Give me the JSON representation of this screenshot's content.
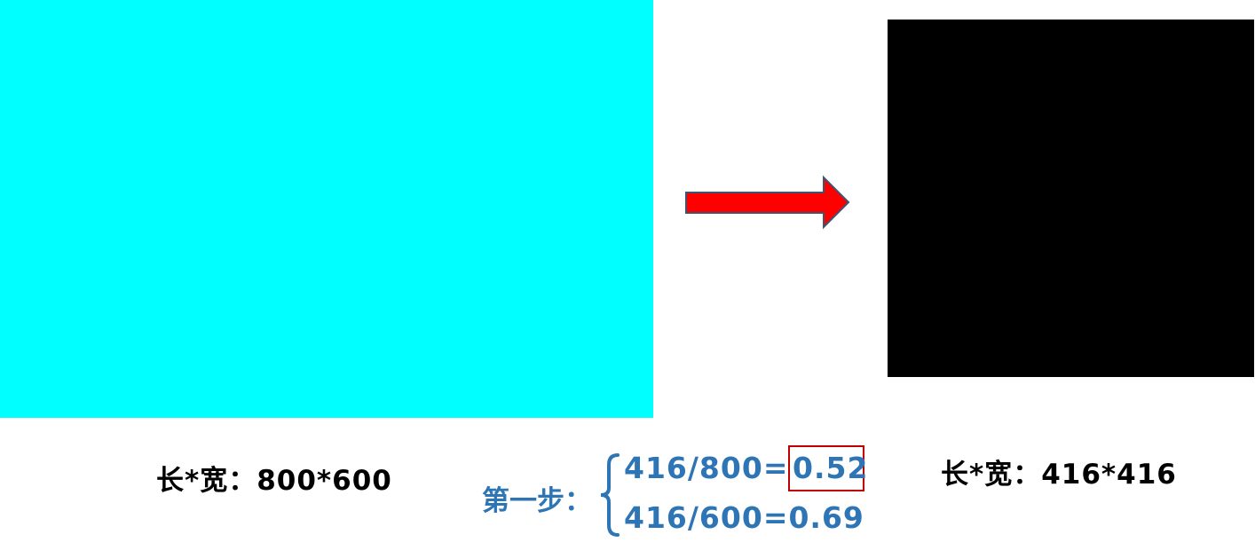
{
  "colors": {
    "source_fill": "#00ffff",
    "target_fill": "#000000",
    "arrow_fill": "#ff0000",
    "arrow_stroke": "#41546e",
    "step_text": "#2e75b6",
    "highlight_border": "#c00000",
    "label_text": "#000000"
  },
  "source": {
    "dimension_label": "长*宽：800*600"
  },
  "target": {
    "dimension_label": "长*宽：416*416"
  },
  "arrow": {
    "icon": "right-arrow-icon"
  },
  "step": {
    "label": "第一步：",
    "equation_1_lhs": "416/800=",
    "equation_1_result": "0.52",
    "equation_2": "416/600=0.69"
  }
}
